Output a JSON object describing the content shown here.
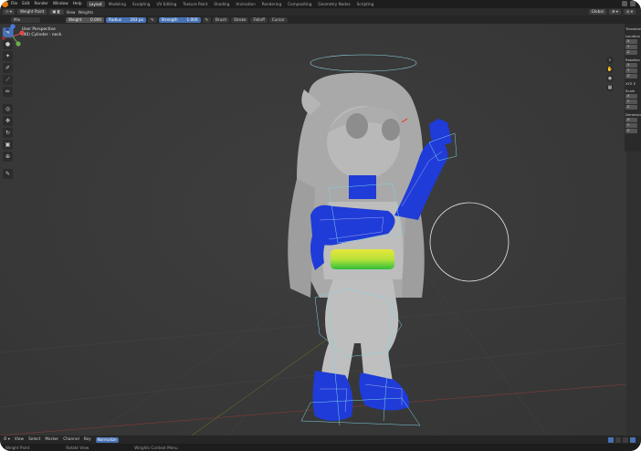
{
  "menubar": {
    "items": [
      "File",
      "Edit",
      "Render",
      "Window",
      "Help"
    ],
    "workspaces": [
      "Layout",
      "Modeling",
      "Sculpting",
      "UV Editing",
      "Texture Paint",
      "Shading",
      "Animation",
      "Rendering",
      "Compositing",
      "Geometry Nodes",
      "Scripting"
    ],
    "active_workspace": "Layout"
  },
  "header": {
    "mode": "Weight Paint",
    "view": "View",
    "weights": "Weights",
    "orientation": "Global"
  },
  "toolsettings": {
    "brush": "Mix",
    "weight_label": "Weight",
    "weight_value": "0.000",
    "radius_label": "Radius",
    "radius_value": "283 px",
    "strength_label": "Strength",
    "strength_value": "1.000",
    "menus": [
      "Brush",
      "Stroke",
      "Falloff",
      "Cursor"
    ]
  },
  "viewport": {
    "view_name": "User Perspective",
    "object_info": "(40) Cylinder : neck"
  },
  "toolbar": {
    "tools": [
      "brush-tool",
      "blur-tool",
      "average-tool",
      "smear-tool",
      "gradient-tool",
      "sample-tool",
      "annotate-tool",
      "move-tool",
      "rotate-tool",
      "scale-tool",
      "transform-tool",
      "measure-tool"
    ]
  },
  "npanel": {
    "title": "Transform",
    "location_label": "Location",
    "rotation_label": "Rotation",
    "rotation_mode": "XYZ E",
    "scale_label": "Scale",
    "dimensions_label": "Dimensions",
    "axes": [
      "X",
      "Y",
      "Z"
    ]
  },
  "timeline": {
    "items": [
      "View",
      "Select",
      "Marker",
      "Channel",
      "Key"
    ],
    "keying": "Normalize"
  },
  "statusbar": {
    "left": "Weight Paint",
    "middle": "Rotate View",
    "right": "Weights Context Menu"
  },
  "colors": {
    "accent": "#4772b3",
    "viewport_bg": "#3a3a3a",
    "weight_blue": "#1f3bd8",
    "weight_yellow": "#e8e83a",
    "weight_green": "#3ad83a"
  }
}
